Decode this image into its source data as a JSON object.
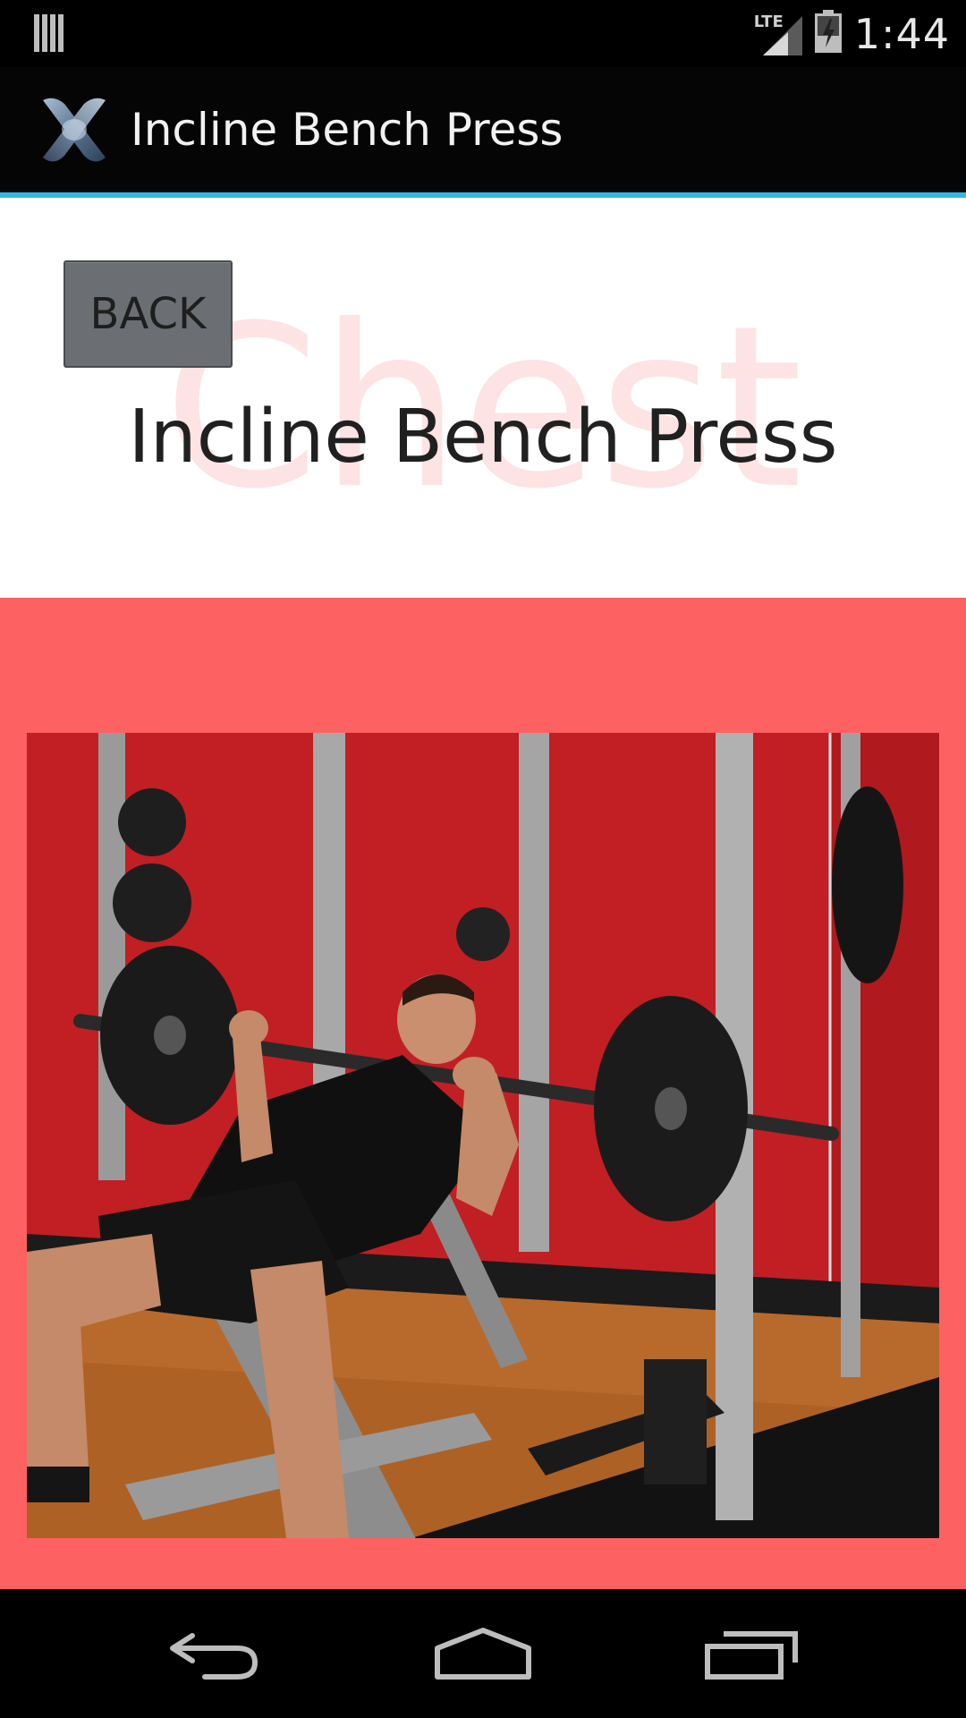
{
  "status_bar": {
    "network": "LTE",
    "time": "1:44"
  },
  "action_bar": {
    "title": "Incline Bench Press",
    "logo_icon": "app-x-logo-icon"
  },
  "header": {
    "back_label": "BACK",
    "watermark": "Chest",
    "exercise_title": "Incline Bench Press"
  },
  "colors": {
    "action_bar_accent": "#33b5e5",
    "image_background": "#fe6161",
    "watermark": "#fde3e3",
    "button": "#6b6f73"
  },
  "photo": {
    "description_icon": "incline-bench-press-photo"
  },
  "nav": {
    "icons": [
      "back-icon",
      "home-icon",
      "recent-apps-icon"
    ]
  }
}
